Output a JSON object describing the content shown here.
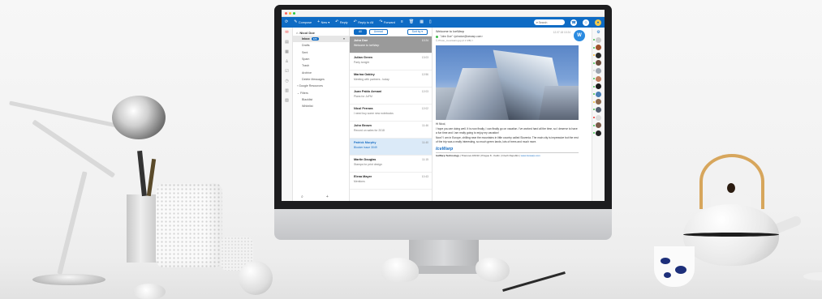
{
  "toolbar": {
    "compose": "Compose",
    "new": "New ▾",
    "reply": "Reply",
    "reply_all": "Reply to All",
    "forward": "Forward",
    "search_placeholder": "▾ Search"
  },
  "account": {
    "name": "Nicol Doe"
  },
  "folders": [
    {
      "label": "Inbox",
      "badge": "123"
    },
    {
      "label": "Drafts"
    },
    {
      "label": "Sent"
    },
    {
      "label": "Spam"
    },
    {
      "label": "Trash"
    },
    {
      "label": "Archive"
    },
    {
      "label": "Delete Messages"
    },
    {
      "label": "Google Resources"
    },
    {
      "label": "Filters"
    },
    {
      "label": "Blacklist"
    },
    {
      "label": "Whitelist"
    }
  ],
  "filters": {
    "all": "All",
    "unread": "Unread",
    "sort": "Sort by ▾"
  },
  "messages": [
    {
      "from": "John Doe",
      "subject": "Welcome to IceWarp",
      "time": "10:24"
    },
    {
      "from": "Julian Green",
      "subject": "Party tonight",
      "time": "13:03"
    },
    {
      "from": "Marina Oakley",
      "subject": "Meeting with partners - today",
      "time": "12:56"
    },
    {
      "from": "Juan Pablo Armani",
      "subject": "Plans for JoFM",
      "time": "12:03"
    },
    {
      "from": "Nicol Ferrara",
      "subject": "I need buy some new notebooks",
      "time": "12:02"
    },
    {
      "from": "John Brown",
      "subject": "Record on sales for 2018",
      "time": "11:46"
    },
    {
      "from": "Patrick Murphy",
      "subject": "Blocker issue 3049",
      "time": "11:40"
    },
    {
      "from": "Martin Douglas",
      "subject": "Stamps for print design",
      "time": "11:15"
    },
    {
      "from": "Elena Mayer",
      "subject": "Mentions",
      "time": "10:43"
    }
  ],
  "reader": {
    "title": "Welcome to IceWarp",
    "date": "12.07.18 10:24",
    "avatar": "W",
    "from": "\"John Doe\" <johndoe@icewarp.com>",
    "attachment": "Photo_mountains.jpg (2.1 MB) ▾",
    "greeting": "Hi Nicol,",
    "para1": "I hope you are doing well. It is now finally, I can finally go on vacation. I've worked hard all the time, so I deserve to have a fun time and I am really going to enjoy my vacation!",
    "para2": "Now? I am in Europe, chilling near the mountains in little country called Slovenia. The main city is impressive but the rest of the trip was a really interesting, so much green lands, lots of trees and much more.",
    "sig_logo": "IceWarp",
    "sig_company": "IceWarp Technology",
    "sig_address": " | Thamova 166/10 | Prague 8 - Karlin | Czech Republic | ",
    "sig_url": "www.icewarp.com"
  },
  "colors": {
    "accent": "#0e6bc4",
    "selected_row": "#9a9a9a",
    "highlight_row": "#dbeaf8"
  }
}
